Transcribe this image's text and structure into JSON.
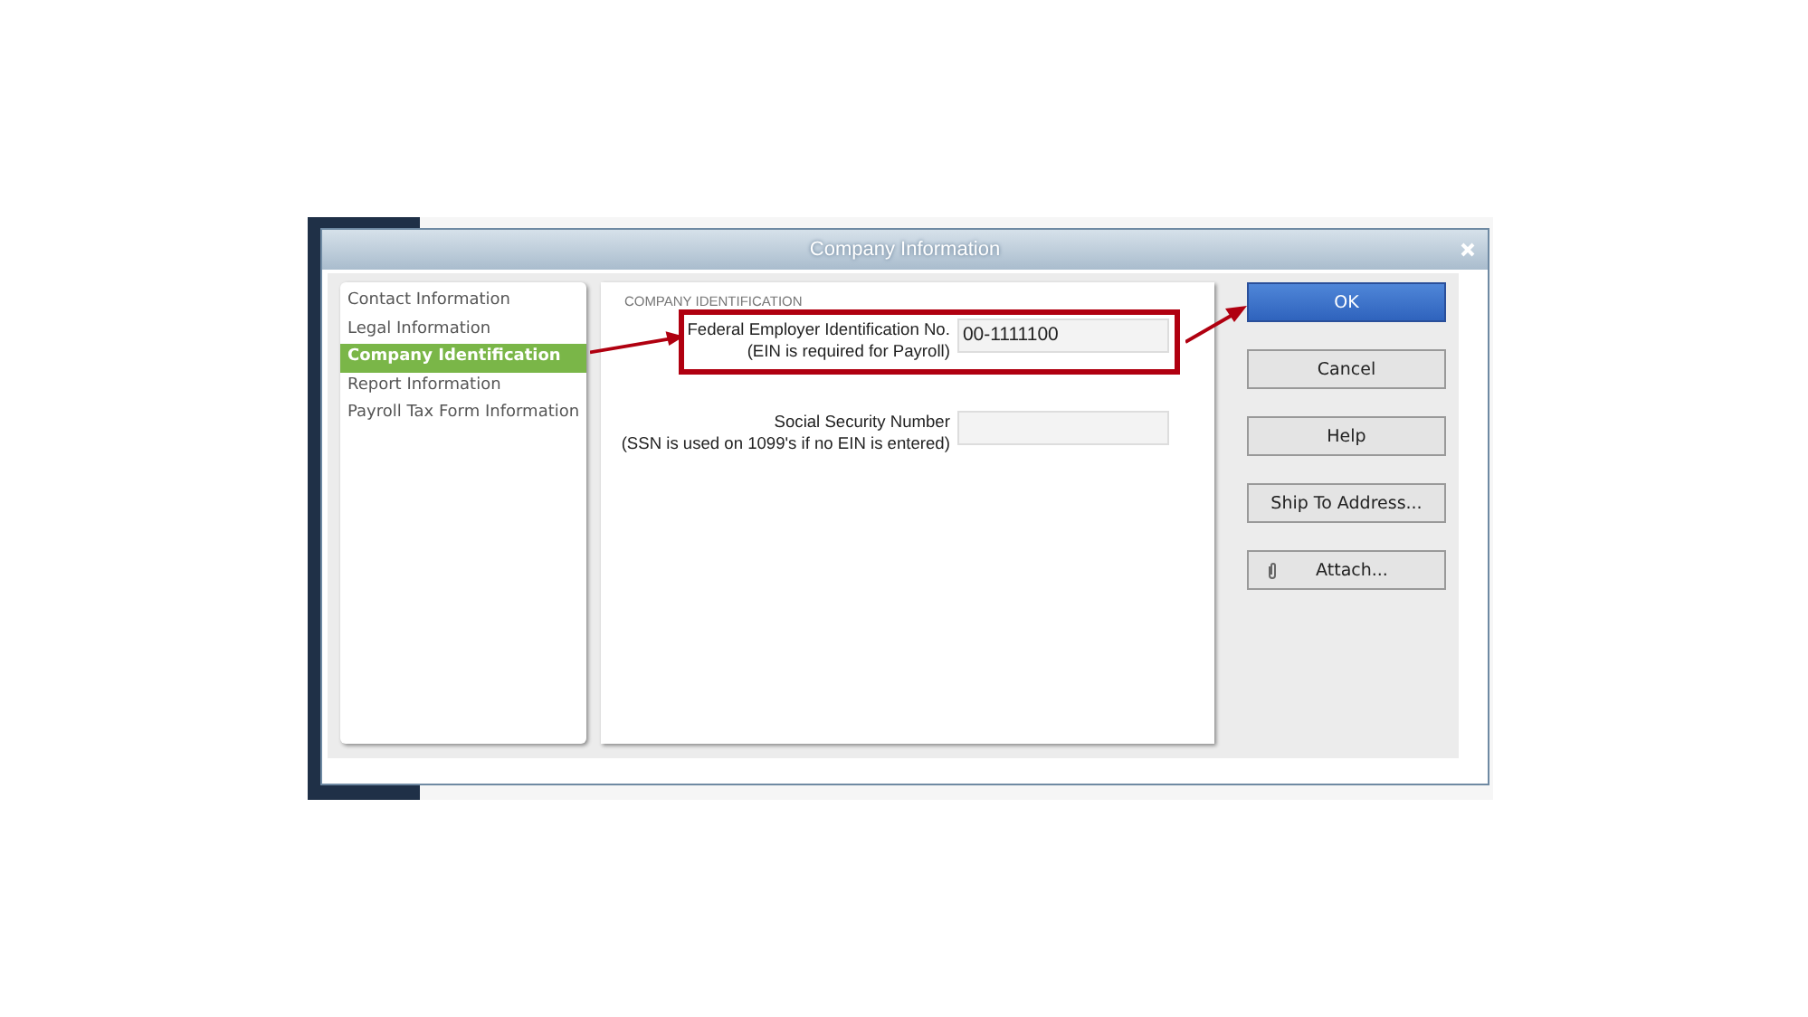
{
  "window": {
    "title": "Company Information"
  },
  "sidebar": {
    "items": [
      {
        "label": "Contact Information",
        "selected": false
      },
      {
        "label": "Legal Information",
        "selected": false
      },
      {
        "label": "Company Identification",
        "selected": true
      },
      {
        "label": "Report Information",
        "selected": false
      },
      {
        "label": "Payroll Tax Form Information",
        "selected": false
      }
    ]
  },
  "section": {
    "heading": "COMPANY IDENTIFICATION",
    "fields": [
      {
        "label": "Federal Employer Identification No.",
        "note": "(EIN is required for Payroll)",
        "value": "00-1111100",
        "highlighted": true
      },
      {
        "label": "Social Security Number",
        "note": "(SSN is used on 1099's if no EIN is entered)",
        "highlighted": false
      }
    ]
  },
  "buttons": [
    {
      "label": "OK",
      "kind": "primary"
    },
    {
      "label": "Cancel",
      "kind": "plain"
    },
    {
      "label": "Help",
      "kind": "plain"
    },
    {
      "label": "Ship To Address...",
      "kind": "plain"
    },
    {
      "label": "Attach...",
      "kind": "attach"
    }
  ]
}
